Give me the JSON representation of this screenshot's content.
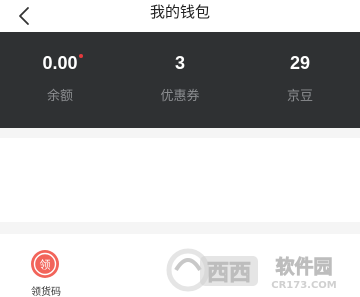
{
  "navbar": {
    "title": "我的钱包",
    "back_icon": "chevron-left-icon"
  },
  "stats": [
    {
      "value": "0.00",
      "label": "余额",
      "has_red_dot": true
    },
    {
      "value": "3",
      "label": "优惠券",
      "has_red_dot": false
    },
    {
      "value": "29",
      "label": "京豆",
      "has_red_dot": false
    }
  ],
  "tools": [
    {
      "label": "领货码",
      "icon": "pickup-code-icon",
      "icon_glyph": "领",
      "color": "#f2645a"
    }
  ],
  "colors": {
    "panel_bg": "#2f3133",
    "separator_bg": "#f5f5f5",
    "accent_red": "#e4393c"
  },
  "watermark": {
    "logo_text": "西西",
    "brand_text": "软件园",
    "domain_text": "CR173.COM"
  }
}
